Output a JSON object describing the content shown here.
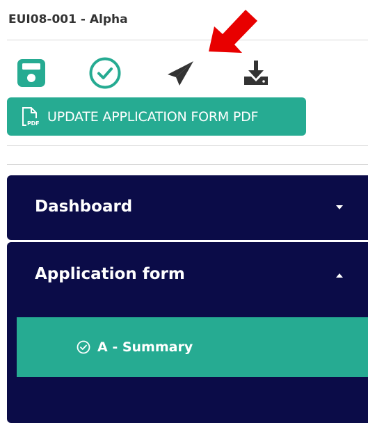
{
  "header": {
    "project_title": "EUI08-001 - Alpha"
  },
  "toolbar": {
    "icons": [
      "save-icon",
      "check-circle-icon",
      "send-icon",
      "download-icon"
    ],
    "pdf_button_label": "UPDATE APPLICATION FORM PDF",
    "pdf_icon_text": "PDF"
  },
  "nav": {
    "dashboard_label": "Dashboard",
    "application_form_label": "Application form",
    "sub_items": [
      {
        "label": "A - Summary"
      }
    ]
  },
  "colors": {
    "accent": "#26ab92",
    "nav_bg": "#0b0c48",
    "annotation_arrow": "#e80000",
    "icon_dark": "#333333"
  }
}
